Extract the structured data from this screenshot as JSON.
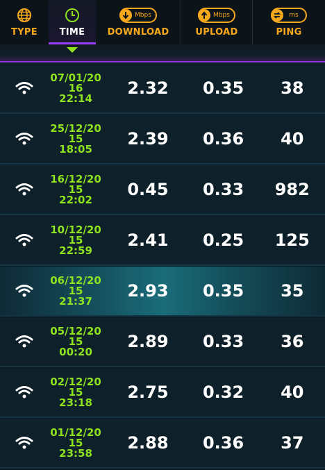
{
  "header": {
    "type_label": "TYPE",
    "time_label": "TIME",
    "download_label": "DOWNLOAD",
    "download_unit": "Mbps",
    "upload_label": "UPLOAD",
    "upload_unit": "Mbps",
    "ping_label": "PING",
    "ping_unit": "ms"
  },
  "colors": {
    "accent": "#f7a81d",
    "time_green": "#8ee21e",
    "active_purple": "#9b3cff"
  },
  "results": [
    {
      "date": "07/01/20",
      "year_part": "16",
      "clock": "22:14",
      "download": "2.32",
      "upload": "0.35",
      "ping": "38"
    },
    {
      "date": "25/12/20",
      "year_part": "15",
      "clock": "18:05",
      "download": "2.39",
      "upload": "0.36",
      "ping": "40"
    },
    {
      "date": "16/12/20",
      "year_part": "15",
      "clock": "22:02",
      "download": "0.45",
      "upload": "0.33",
      "ping": "982"
    },
    {
      "date": "10/12/20",
      "year_part": "15",
      "clock": "22:59",
      "download": "2.41",
      "upload": "0.25",
      "ping": "125"
    },
    {
      "date": "06/12/20",
      "year_part": "15",
      "clock": "21:37",
      "download": "2.93",
      "upload": "0.35",
      "ping": "35"
    },
    {
      "date": "05/12/20",
      "year_part": "15",
      "clock": "00:20",
      "download": "2.89",
      "upload": "0.33",
      "ping": "36"
    },
    {
      "date": "02/12/20",
      "year_part": "15",
      "clock": "23:18",
      "download": "2.75",
      "upload": "0.32",
      "ping": "40"
    },
    {
      "date": "01/12/20",
      "year_part": "15",
      "clock": "23:58",
      "download": "2.88",
      "upload": "0.36",
      "ping": "37"
    }
  ]
}
